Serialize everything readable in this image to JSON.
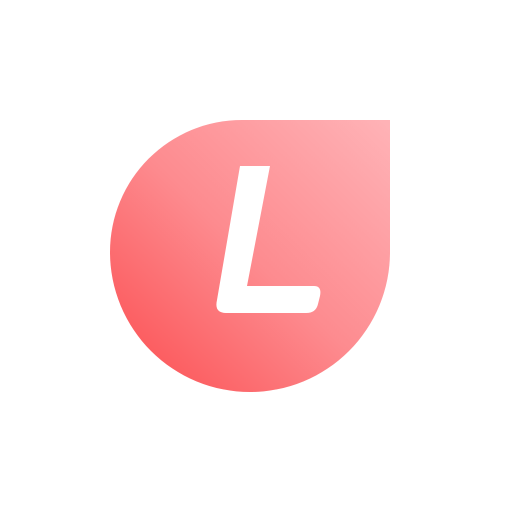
{
  "logo": {
    "letter": "L",
    "colors": {
      "gradient_light": "#ffb3b7",
      "gradient_mid": "#fd8b8f",
      "gradient_dark": "#fb4b4e",
      "letter": "#ffffff",
      "background": "#ffffff"
    }
  }
}
